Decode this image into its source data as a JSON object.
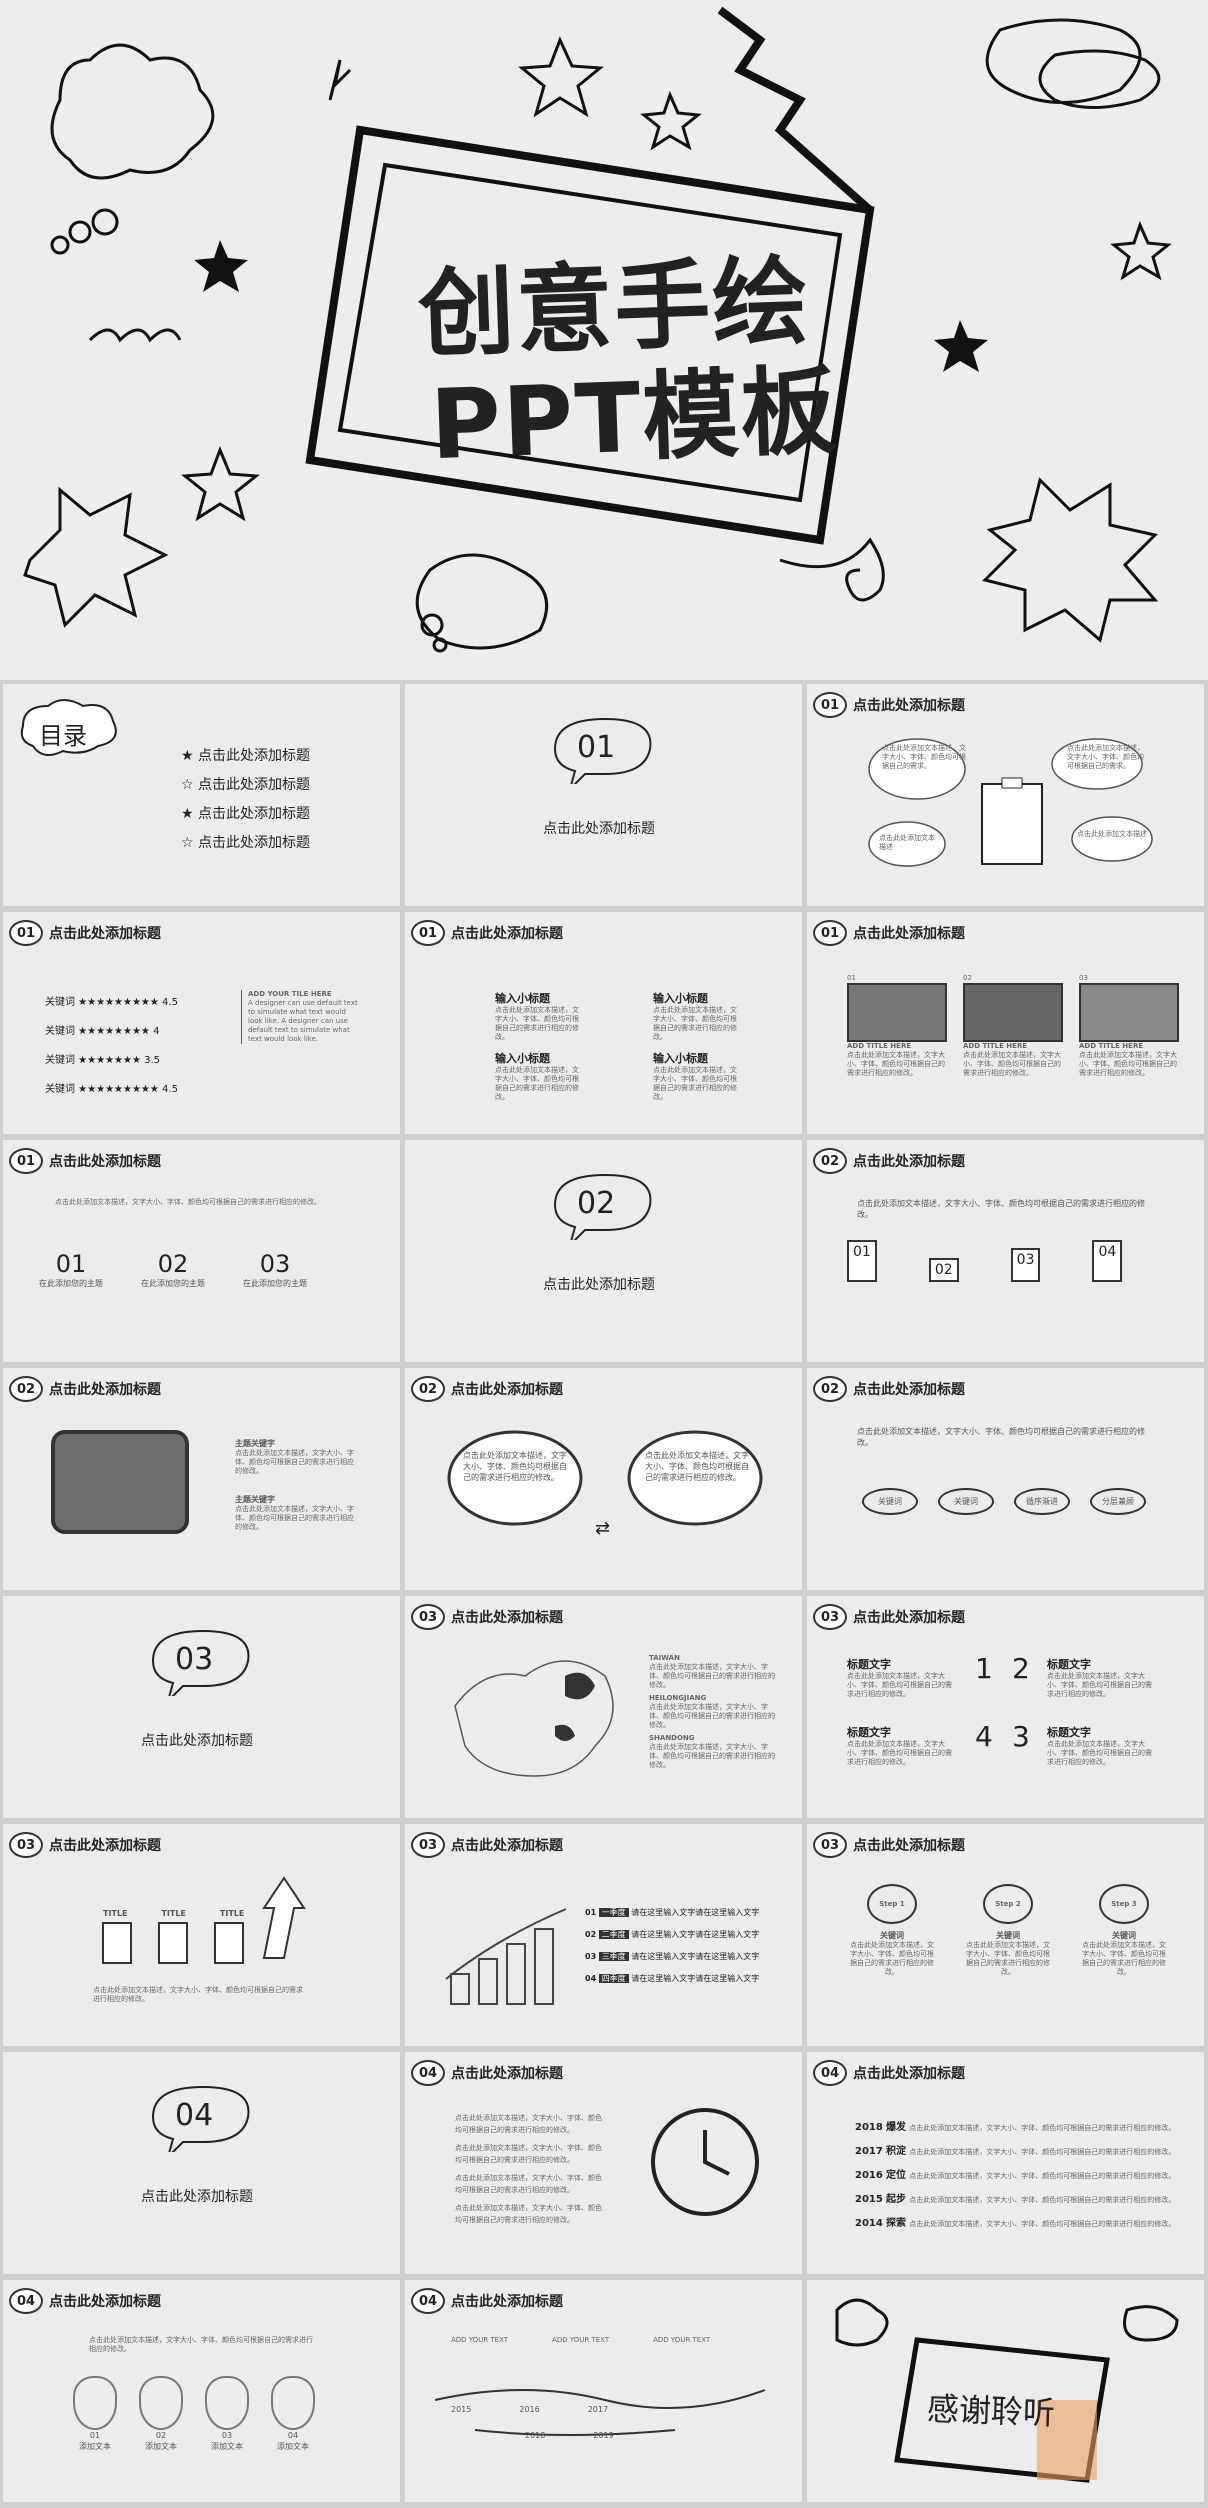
{
  "hero": {
    "title_line1": "创意手绘",
    "title_line2": "PPT模板"
  },
  "toc": {
    "title": "目录",
    "items": [
      "点击此处添加标题",
      "点击此处添加标题",
      "点击此处添加标题",
      "点击此处添加标题"
    ]
  },
  "section_title": "点击此处添加标题",
  "sections": [
    "01",
    "02",
    "03",
    "04"
  ],
  "header_title": "点击此处添加标题",
  "body_text": "点击此处添加文本描述，文字大小、字体、颜色均可根据自己的需求进行相应的修改。",
  "clouds_text": [
    "点击此处添加文本描述，文字大小、字体、颜色均可根据自己的需求进行相应的修改。",
    "点击此处添加文本描述，文字大小、字体、颜色均可根据自己的需求。",
    "点击此处添加文本描述",
    "点击此处添加文本描述"
  ],
  "ratings": [
    {
      "label": "关键词",
      "score": "4.5"
    },
    {
      "label": "关键词",
      "score": "4"
    },
    {
      "label": "关键词",
      "score": "3.5"
    },
    {
      "label": "关键词",
      "score": "4.5"
    }
  ],
  "rating_note": {
    "head": "ADD YOUR TILE HERE",
    "text": "A designer can use default text to simulate what text would look like. A designer can use default text to simulate what text would look like."
  },
  "subtitles": [
    "输入小标题",
    "输入小标题",
    "输入小标题",
    "输入小标题"
  ],
  "photos": {
    "nums": [
      "01",
      "02",
      "03"
    ],
    "head": "ADD TITLE HERE"
  },
  "themes": {
    "nums": [
      "01",
      "02",
      "03"
    ],
    "label": "在此添加您的主题"
  },
  "flags": [
    "01",
    "02",
    "03",
    "04"
  ],
  "keywords": {
    "main": "主题关键字"
  },
  "flow": {
    "items": [
      "关键词",
      "关键词",
      "循序渐进",
      "分层兼顾"
    ]
  },
  "map": {
    "regions": [
      "TAIWAN",
      "HEILONGJIANG",
      "SHANDONG"
    ]
  },
  "numbers": {
    "label": "标题文字",
    "digits": [
      "1",
      "2",
      "4",
      "3"
    ]
  },
  "three_title": "TITLE",
  "rows": {
    "labels": [
      "一季度",
      "二季度",
      "三季度",
      "四季度"
    ],
    "nums": [
      "01",
      "02",
      "03",
      "04"
    ],
    "text": "请在这里输入文字请在这里输入文字"
  },
  "steps": {
    "labels": [
      "Step 1",
      "Step 2",
      "Step 3"
    ],
    "kw": "关键词"
  },
  "years": [
    "2018",
    "2017",
    "2016",
    "2015",
    "2014"
  ],
  "year_tags": [
    "爆发",
    "积淀",
    "定位",
    "起步",
    "探索"
  ],
  "icons_row": {
    "nums": [
      "01",
      "02",
      "03",
      "04"
    ],
    "label": "添加文本"
  },
  "timeline": {
    "years": [
      "2015",
      "2016",
      "2017",
      "2018",
      "2019"
    ],
    "head": "ADD YOUR TEXT"
  },
  "thanks": "感谢聆听",
  "colors": {
    "bg": "#ececec",
    "ink": "#222222",
    "accent": "#e8a060"
  }
}
